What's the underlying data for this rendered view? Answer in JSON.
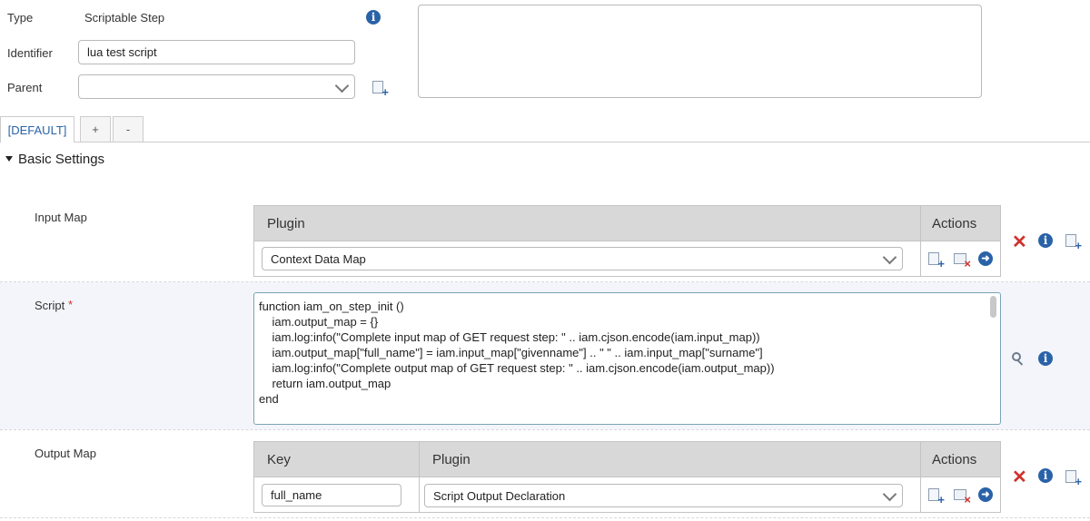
{
  "header": {
    "type_label": "Type",
    "type_value": "Scriptable Step",
    "identifier_label": "Identifier",
    "identifier_value": "lua test script",
    "parent_label": "Parent",
    "parent_value": ""
  },
  "tabs": [
    {
      "label": "[DEFAULT]"
    },
    {
      "label": "+"
    },
    {
      "label": "-"
    }
  ],
  "section": {
    "title": "Basic Settings"
  },
  "input_map": {
    "label": "Input Map",
    "headers": {
      "plugin": "Plugin",
      "actions": "Actions"
    },
    "plugin_value": "Context Data Map"
  },
  "script": {
    "label": "Script",
    "required_mark": "*",
    "lines": [
      "function iam_on_step_init ()",
      "    iam.output_map = {}",
      "    iam.log:info(\"Complete input map of GET request step: \" .. iam.cjson.encode(iam.input_map))",
      "    iam.output_map[\"full_name\"] = iam.input_map[\"givenname\"] .. \" \" .. iam.input_map[\"surname\"]",
      "    iam.log:info(\"Complete output map of GET request step: \" .. iam.cjson.encode(iam.output_map))",
      "    return iam.output_map",
      "end"
    ]
  },
  "output_map": {
    "label": "Output Map",
    "headers": {
      "key": "Key",
      "plugin": "Plugin",
      "actions": "Actions"
    },
    "key_value": "full_name",
    "plugin_value": "Script Output Declaration"
  },
  "colors": {
    "accent": "#2a62a8",
    "danger": "#d0312d",
    "script_bg": "#f4f5fb"
  }
}
